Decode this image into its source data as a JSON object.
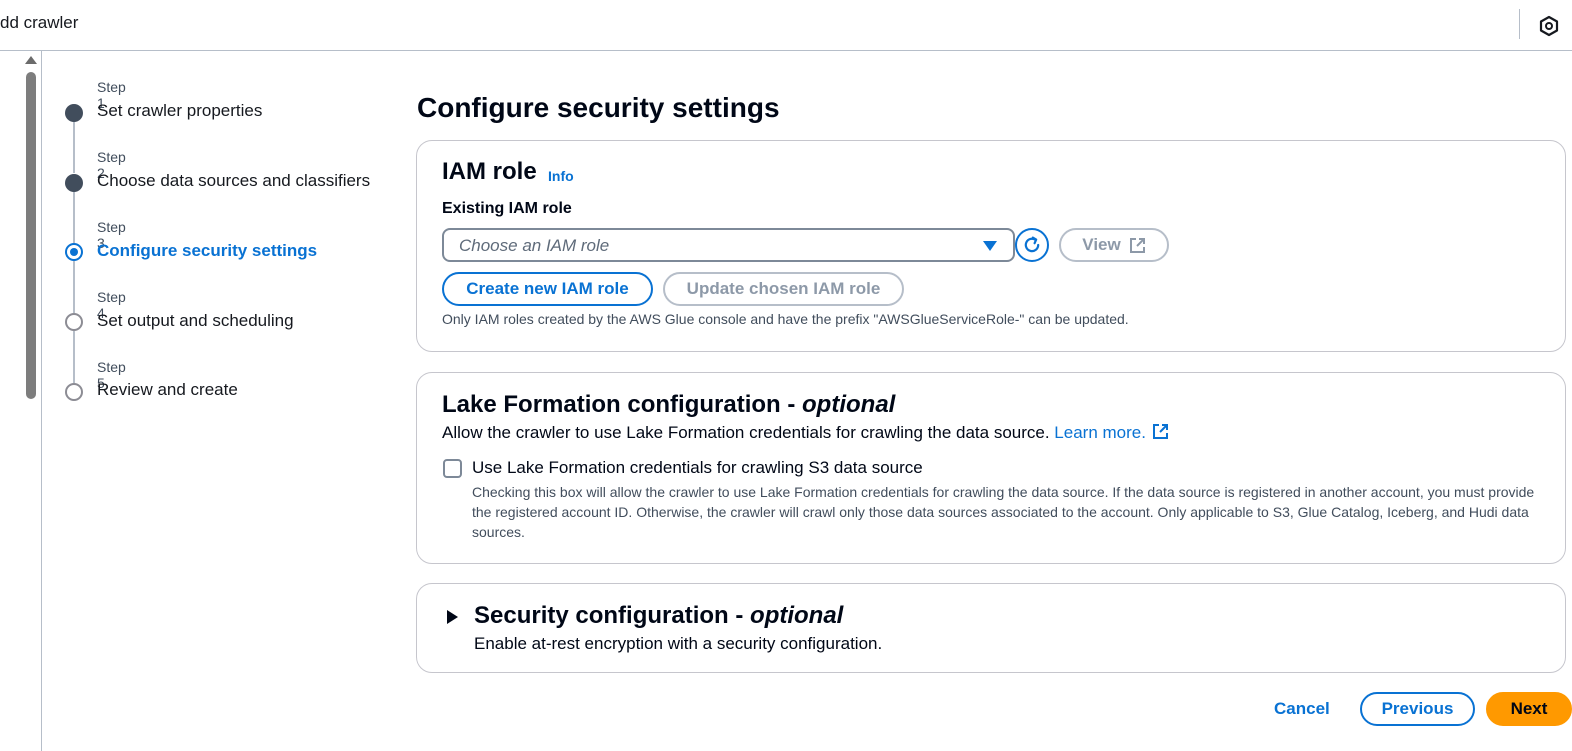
{
  "header": {
    "title": "dd crawler"
  },
  "colors": {
    "accent": "#0972d3",
    "primary_button": "#ff9900",
    "text": "#000716",
    "muted": "#414d5c",
    "border": "#c6c6cd"
  },
  "steps": [
    {
      "number": "Step 1",
      "label": "Set crawler properties",
      "state": "done"
    },
    {
      "number": "Step 2",
      "label": "Choose data sources and classifiers",
      "state": "done"
    },
    {
      "number": "Step 3",
      "label": "Configure security settings",
      "state": "current"
    },
    {
      "number": "Step 4",
      "label": "Set output and scheduling",
      "state": "todo"
    },
    {
      "number": "Step 5",
      "label": "Review and create",
      "state": "todo"
    }
  ],
  "page": {
    "title": "Configure security settings"
  },
  "iam": {
    "heading": "IAM role",
    "info_label": "Info",
    "field_label": "Existing IAM role",
    "select_placeholder": "Choose an IAM role",
    "view_label": "View",
    "create_label": "Create new IAM role",
    "update_label": "Update chosen IAM role",
    "hint": "Only IAM roles created by the AWS Glue console and have the prefix \"AWSGlueServiceRole-\" can be updated."
  },
  "lake": {
    "heading": "Lake Formation configuration - ",
    "heading_optional": "optional",
    "description": "Allow the crawler to use Lake Formation credentials for crawling the data source. ",
    "learn_more": "Learn more.",
    "checkbox_label": "Use Lake Formation credentials for crawling S3 data source",
    "checkbox_checked": false,
    "checkbox_description": "Checking this box will allow the crawler to use Lake Formation credentials for crawling the data source. If the data source is registered in another account, you must provide the registered account ID. Otherwise, the crawler will crawl only those data sources associated to the account. Only applicable to S3, Glue Catalog, Iceberg, and Hudi data sources."
  },
  "security": {
    "heading": "Security configuration - ",
    "heading_optional": "optional",
    "description": "Enable at-rest encryption with a security configuration."
  },
  "footer": {
    "cancel_label": "Cancel",
    "previous_label": "Previous",
    "next_label": "Next"
  }
}
